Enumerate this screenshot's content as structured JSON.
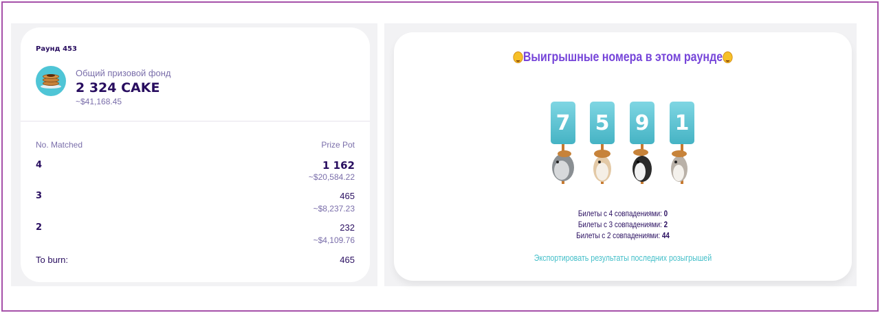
{
  "round": {
    "label": "Раунд 453"
  },
  "pool": {
    "label": "Общий призовой фонд",
    "value": "2 324 CAKE",
    "usd": "~$41,168.45"
  },
  "table": {
    "col_matched": "No. Matched",
    "col_prize": "Prize Pot",
    "rows": [
      {
        "matched": "4",
        "prize": "1 162",
        "usd": "~$20,584.22"
      },
      {
        "matched": "3",
        "prize": "465",
        "usd": "~$8,237.23"
      },
      {
        "matched": "2",
        "prize": "232",
        "usd": "~$4,109.76"
      }
    ],
    "burn_label": "To burn:",
    "burn_value": "465"
  },
  "winning": {
    "title": "Выигрышные номера в этом раунде",
    "numbers": [
      "7",
      "5",
      "9",
      "1"
    ],
    "stats": [
      {
        "label": "Билеты с 4 совпадениями: ",
        "value": "0"
      },
      {
        "label": "Билеты с 3 совпадениями: ",
        "value": "2"
      },
      {
        "label": "Билеты с 2 совпадениями: ",
        "value": "44"
      }
    ],
    "export_link": "Экспортировать результаты последних розыгрышей"
  },
  "colors": {
    "frame": "#a54fa8",
    "title_purple": "#7645d9",
    "text_dark": "#280d5f",
    "text_muted": "#7a6eaa",
    "accent_teal": "#44bfc9"
  },
  "icons": [
    "cake-icon",
    "party-face-icon",
    "bunny-mascot-icon"
  ]
}
